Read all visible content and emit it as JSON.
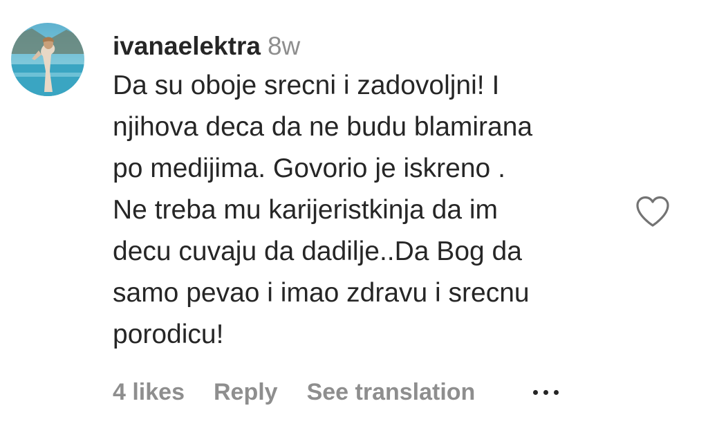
{
  "comment": {
    "username": "ivanaelektra",
    "timestamp": "8w",
    "lines": [
      "Da su oboje srecni i zadovoljni! I",
      "njihova deca da ne budu blamirana",
      "po medijima. Govorio je iskreno .",
      "Ne treba mu karijeristkinja da im",
      "decu cuvaju da dadilje..Da Bog da",
      "samo pevao i imao zdravu i srecnu",
      "porodicu!"
    ]
  },
  "actions": {
    "likes": "4 likes",
    "reply": "Reply",
    "translate": "See translation"
  },
  "icons": {
    "like": "heart-outline-icon",
    "more": "more-options-icon"
  },
  "colors": {
    "text": "#262626",
    "secondary": "#8e8e8e"
  }
}
